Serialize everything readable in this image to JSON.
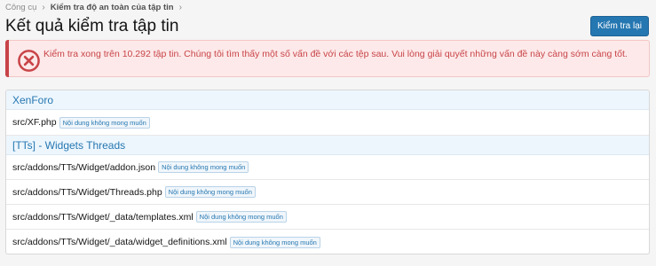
{
  "breadcrumb": {
    "items": [
      {
        "label": "Công cụ"
      },
      {
        "label": "Kiểm tra độ an toàn của tập tin"
      }
    ]
  },
  "header": {
    "title": "Kết quả kiểm tra tập tin",
    "action_label": "Kiểm tra lại"
  },
  "alert": {
    "message": "Kiểm tra xong trên 10.292 tập tin. Chúng tôi tìm thấy một số vấn đề với các tệp sau. Vui lòng giải quyết những vấn đề này càng sớm càng tốt.",
    "icon": "error-circle-x-icon"
  },
  "groups": [
    {
      "title": "XenForo",
      "files": [
        {
          "path": "src/XF.php",
          "badge": "Nội dung không mong muốn"
        }
      ]
    },
    {
      "title": "[TTs] - Widgets Threads",
      "files": [
        {
          "path": "src/addons/TTs/Widget/addon.json",
          "badge": "Nội dung không mong muốn"
        },
        {
          "path": "src/addons/TTs/Widget/Threads.php",
          "badge": "Nội dung không mong muốn"
        },
        {
          "path": "src/addons/TTs/Widget/_data/templates.xml",
          "badge": "Nội dung không mong muốn"
        },
        {
          "path": "src/addons/TTs/Widget/_data/widget_definitions.xml",
          "badge": "Nội dung không mong muốn"
        }
      ]
    }
  ],
  "colors": {
    "accent": "#2577b1",
    "error": "#c84448",
    "error_bg": "#fde9e9"
  }
}
